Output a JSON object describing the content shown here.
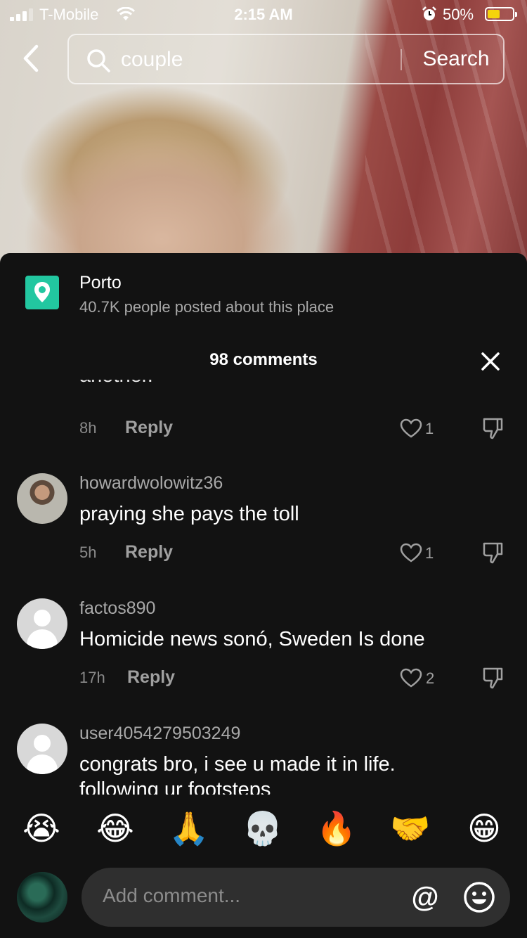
{
  "status_bar": {
    "carrier": "T-Mobile",
    "time": "2:15 AM",
    "battery_percent": "50%",
    "battery_level": 0.5,
    "signal_bars": 3
  },
  "search": {
    "query": "couple",
    "submit_label": "Search"
  },
  "place": {
    "name": "Porto",
    "subtitle": "40.7K people posted about this place",
    "icon": "location-pin-icon"
  },
  "comments_header": "98 comments",
  "truncated_comment": {
    "text_tail": "another.¨",
    "age": "8h",
    "reply_label": "Reply",
    "likes": "1"
  },
  "comments": [
    {
      "username": "howardwolowitz36",
      "text": "praying she pays the toll",
      "age": "5h",
      "reply_label": "Reply",
      "likes": "1",
      "avatar": "photo"
    },
    {
      "username": "factos890",
      "text": "Homicide news sonó, Sweden Is done",
      "age": "17h",
      "reply_label": "Reply",
      "likes": "2",
      "avatar": "default"
    },
    {
      "username": "user4054279503249",
      "text": "congrats bro, i see u made it in life.",
      "text_overflow": "following ur footsteps",
      "avatar": "default"
    }
  ],
  "quick_emojis": [
    "😭",
    "😂",
    "🙏",
    "💀",
    "🔥",
    "🤝",
    "😁"
  ],
  "comment_input": {
    "placeholder": "Add comment...",
    "mention_symbol": "@"
  },
  "colors": {
    "sheet_bg": "#121212",
    "place_icon_bg": "#22c7a0",
    "battery_fill": "#f5d30c",
    "input_bg": "#2f2f2f"
  }
}
